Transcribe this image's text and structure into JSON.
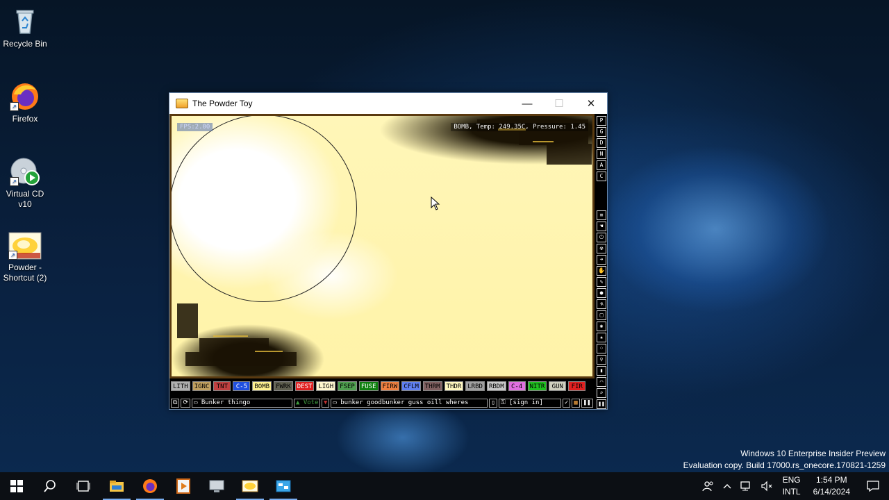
{
  "desktop": {
    "icons": [
      {
        "label": "Recycle Bin",
        "icon": "recycle-bin-icon"
      },
      {
        "label": "Firefox",
        "icon": "firefox-icon"
      },
      {
        "label": "Virtual CD v10",
        "icon": "virtual-cd-icon"
      },
      {
        "label": "Powder - Shortcut (2)",
        "icon": "powder-toy-icon"
      }
    ]
  },
  "window": {
    "title": "The Powder Toy",
    "minimize_glyph": "—",
    "maximize_glyph": "☐",
    "close_glyph": "✕"
  },
  "game": {
    "fps_text": "FPS:2.00",
    "hud_text": "BOMB, Temp: 249.35C, Pressure: 1.45",
    "right_buttons": [
      "P",
      "G",
      "D",
      "N",
      "A",
      "C"
    ],
    "tool_icons": [
      "list-icon",
      "pointer-icon",
      "power-icon",
      "radiation-icon",
      "arrow-icon",
      "hand-icon",
      "pen-icon",
      "drop-icon",
      "flask-icon",
      "square-icon",
      "atom-icon",
      "star-icon",
      "dots-icon",
      "bulb-icon",
      "bookmark-icon",
      "tool-icon",
      "search-icon"
    ],
    "elements": [
      {
        "label": "LITH",
        "bg": "#b0b0b0",
        "fg": "#000000"
      },
      {
        "label": "IGNC",
        "bg": "#c0a060",
        "fg": "#000000"
      },
      {
        "label": "TNT",
        "bg": "#c04040",
        "fg": "#000000"
      },
      {
        "label": "C-5",
        "bg": "#2050e0",
        "fg": "#ffffff"
      },
      {
        "label": "BOMB",
        "bg": "#fff090",
        "fg": "#000000"
      },
      {
        "label": "FWRK",
        "bg": "#606050",
        "fg": "#000000"
      },
      {
        "label": "DEST",
        "bg": "#e02020",
        "fg": "#ffffff"
      },
      {
        "label": "LIGH",
        "bg": "#fff8d0",
        "fg": "#000000"
      },
      {
        "label": "FSEP",
        "bg": "#50a050",
        "fg": "#000000"
      },
      {
        "label": "FUSE",
        "bg": "#108010",
        "fg": "#ffffff"
      },
      {
        "label": "FIRW",
        "bg": "#f08040",
        "fg": "#000000"
      },
      {
        "label": "CFLM",
        "bg": "#6080f0",
        "fg": "#000000"
      },
      {
        "label": "THRM",
        "bg": "#806060",
        "fg": "#000000"
      },
      {
        "label": "THDR",
        "bg": "#fff8c0",
        "fg": "#000000"
      },
      {
        "label": "LRBD",
        "bg": "#a0a0a0",
        "fg": "#000000"
      },
      {
        "label": "RBDM",
        "bg": "#c8c8c8",
        "fg": "#000000"
      },
      {
        "label": "C-4",
        "bg": "#e070e0",
        "fg": "#000000"
      },
      {
        "label": "NITR",
        "bg": "#20c020",
        "fg": "#000000"
      },
      {
        "label": "GUN",
        "bg": "#d0d0c0",
        "fg": "#000000"
      },
      {
        "label": "FIR",
        "bg": "#e02020",
        "fg": "#000000"
      }
    ],
    "bottom": {
      "save_name": "Bunker thingo",
      "vote": "Vote",
      "tags": "bunker goodbunker guss oill wheres",
      "sign_in": "[sign in]"
    }
  },
  "watermark": {
    "line1": "Windows 10 Enterprise Insider Preview",
    "line2": "Evaluation copy. Build 17000.rs_onecore.170821-1259"
  },
  "taskbar": {
    "apps": [
      "windows-start-icon",
      "search-icon",
      "task-view-icon",
      "file-explorer-icon",
      "firefox-icon",
      "media-player-icon",
      "computer-icon",
      "powder-toy-icon",
      "control-panel-icon"
    ],
    "lang1": "ENG",
    "lang2": "INTL",
    "time": "1:54 PM",
    "date": "6/14/2024"
  }
}
